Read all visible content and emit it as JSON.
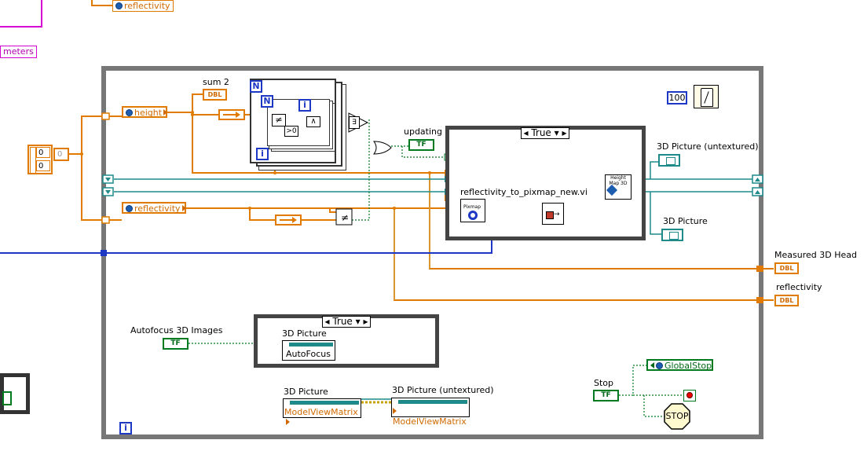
{
  "diagram": {
    "labels": {
      "sum2": "sum 2",
      "updating": "updating",
      "subvi_name": "reflectivity_to_pixmap_new.vi",
      "pic_untextured": "3D Picture (untextured)",
      "pic_3d": "3D Picture",
      "measured_head": "Measured 3D Head",
      "reflectivity_out": "reflectivity",
      "autofocus_images": "Autofocus 3D Images",
      "pic_autofocus_label": "3D Picture",
      "pic_mvm_label": "3D Picture",
      "pic_untextured_mvm_label": "3D Picture (untextured)",
      "stop": "Stop"
    },
    "locals": {
      "top_reflectivity": "reflectivity",
      "height": "height",
      "reflectivity": "reflectivity",
      "global_stop": "GlobalStop",
      "parameters_fragment": "meters"
    },
    "terminals": {
      "dbl": "DBL",
      "tf": "TF",
      "n": "N",
      "i": "i"
    },
    "constants": {
      "wait_ms": "100",
      "array_0a": "0",
      "array_0b": "0",
      "array_idx": "0"
    },
    "case_structures": {
      "main_case": "True",
      "autofocus_case": "True"
    },
    "properties": {
      "autofocus": "AutoFocus",
      "mvm1": "ModelViewMatrix",
      "mvm2": "ModelViewMatrix"
    },
    "subvis": {
      "pixmap": "Pixmap",
      "heightmap": "Height Map 3D",
      "stop_sign": "STOP"
    },
    "colors": {
      "orange_wire": "#e07b00",
      "teal_wire": "#1e8a8a",
      "blue_wire": "#1d38c4",
      "magenta_wire": "#d400d4",
      "green_wire": "#007a1e",
      "frame": "#777777"
    }
  }
}
